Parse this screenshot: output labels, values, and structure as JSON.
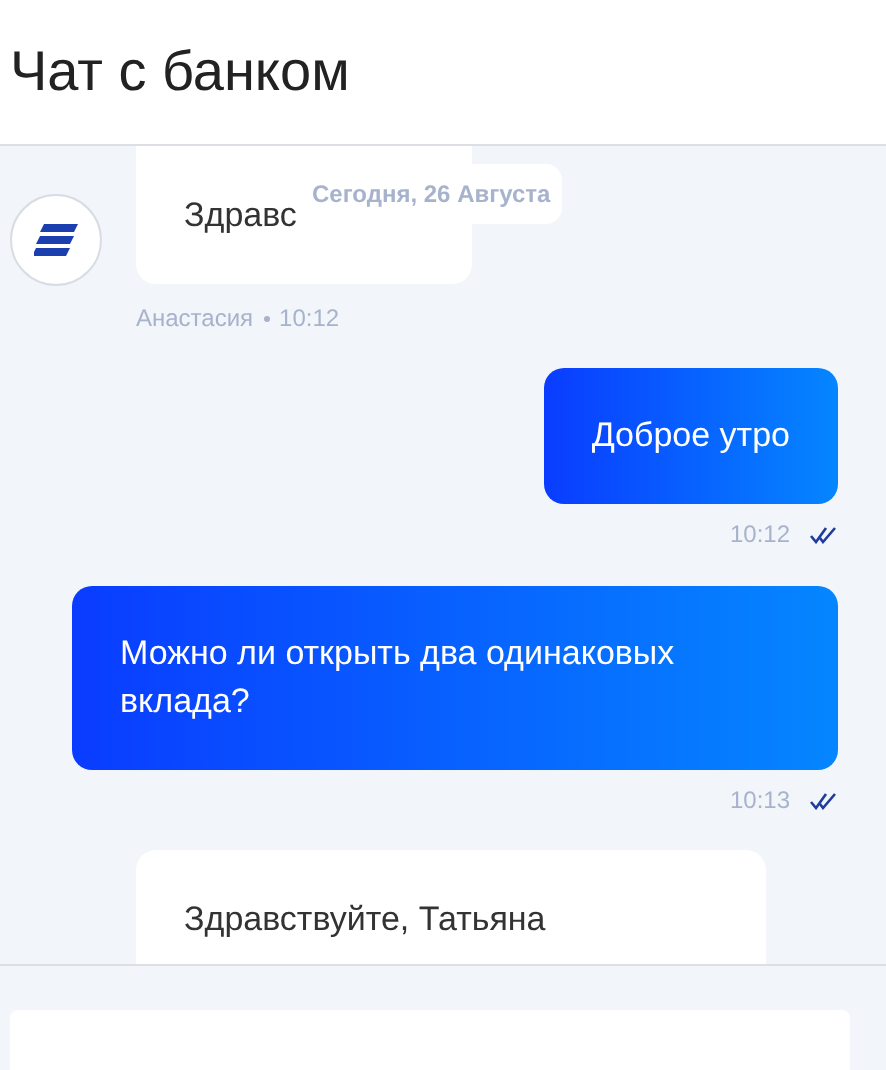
{
  "header": {
    "title": "Чат с банком"
  },
  "date_chip": "Сегодня, 26 Августа",
  "messages": [
    {
      "kind": "incoming",
      "text": "Здравс",
      "sender": "Анастасия",
      "time": "10:12"
    },
    {
      "kind": "outgoing",
      "text": "Доброе утро",
      "time": "10:12",
      "read": true
    },
    {
      "kind": "outgoing",
      "text": "Можно ли открыть два одинаковых вклада?",
      "time": "10:13",
      "read": true
    },
    {
      "kind": "incoming",
      "text": "Здравствуйте, Татьяна"
    }
  ]
}
